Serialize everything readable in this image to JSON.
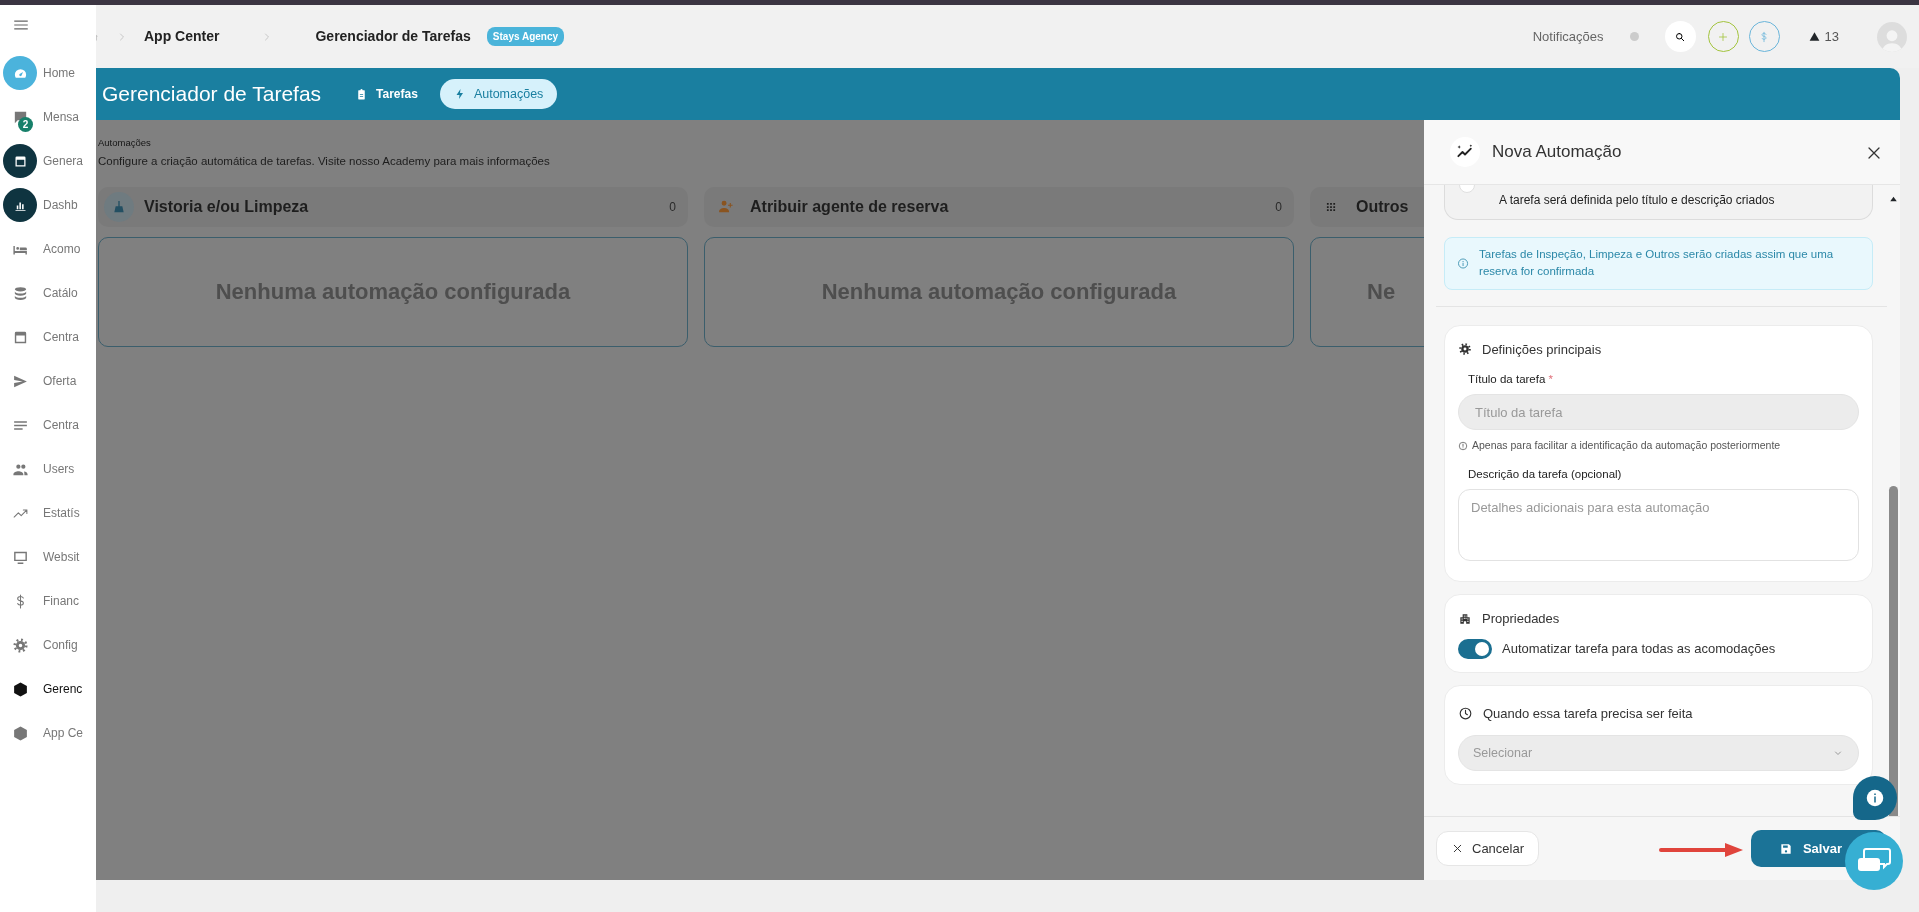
{
  "sidebar": {
    "items": [
      {
        "label": "Home",
        "kind": "circle-light",
        "selected": false
      },
      {
        "label": "Mensa",
        "kind": "plain",
        "badge": "2",
        "selected": false
      },
      {
        "label": "Genera",
        "kind": "circle-dark",
        "selected": false
      },
      {
        "label": "Dashb",
        "kind": "circle-dark",
        "selected": false
      },
      {
        "label": "Acomo",
        "kind": "plain",
        "selected": false
      },
      {
        "label": "Catálo",
        "kind": "plain",
        "selected": false
      },
      {
        "label": "Centra",
        "kind": "plain",
        "selected": false
      },
      {
        "label": "Oferta",
        "kind": "plain",
        "selected": false
      },
      {
        "label": "Centra",
        "kind": "plain",
        "selected": false
      },
      {
        "label": "Users",
        "kind": "plain",
        "selected": false
      },
      {
        "label": "Estatís",
        "kind": "plain",
        "selected": false
      },
      {
        "label": "Websit",
        "kind": "plain",
        "selected": false
      },
      {
        "label": "Financ",
        "kind": "plain",
        "selected": false
      },
      {
        "label": "Config",
        "kind": "plain",
        "selected": false
      },
      {
        "label": "Gerenc",
        "kind": "plain",
        "selected": true
      },
      {
        "label": "App Ce",
        "kind": "plain",
        "selected": false
      }
    ]
  },
  "header": {
    "breadcrumb": [
      "App Center",
      "Gerenciador de Tarefas"
    ],
    "badge": "Stays Agency",
    "notifications_label": "Notificações",
    "alert_count": "13"
  },
  "band": {
    "title": "Gerenciador de Tarefas",
    "tabs": [
      {
        "label": "Tarefas",
        "selected": false
      },
      {
        "label": "Automações",
        "selected": true
      }
    ]
  },
  "content": {
    "section_label": "Automações",
    "description": "Configure a criação automática de tarefas. Visite nosso Academy para mais informações",
    "columns": [
      {
        "title": "Vistoria e/ou Limpeza",
        "count": "0",
        "empty_text": "Nenhuma automação configurada"
      },
      {
        "title": "Atribuir agente de reserva",
        "count": "0",
        "empty_text": "Nenhuma automação configurada"
      },
      {
        "title": "Outros",
        "empty_text": "Ne"
      }
    ]
  },
  "drawer": {
    "title": "Nova Automação",
    "option_selected": false,
    "option_text": "A tarefa será definida pelo título e descrição criados",
    "info_alert": "Tarefas de Inspeção, Limpeza e Outros serão criadas assim que uma reserva for confirmada",
    "main_settings": {
      "heading": "Definições principais",
      "title_label": "Título da tarefa",
      "required_mark": "*",
      "title_placeholder": "Título da tarefa",
      "title_hint": "Apenas para facilitar a identificação da automação posteriormente",
      "description_label": "Descrição da tarefa (opcional)",
      "description_placeholder": "Detalhes adicionais para esta automação"
    },
    "properties": {
      "heading": "Propriedades",
      "toggle_label": "Automatizar tarefa para todas as acomodações",
      "on": true
    },
    "schedule": {
      "heading": "Quando essa tarefa precisa ser feita",
      "select_placeholder": "Selecionar"
    },
    "buttons": {
      "cancel": "Cancelar",
      "save": "Salvar"
    }
  }
}
